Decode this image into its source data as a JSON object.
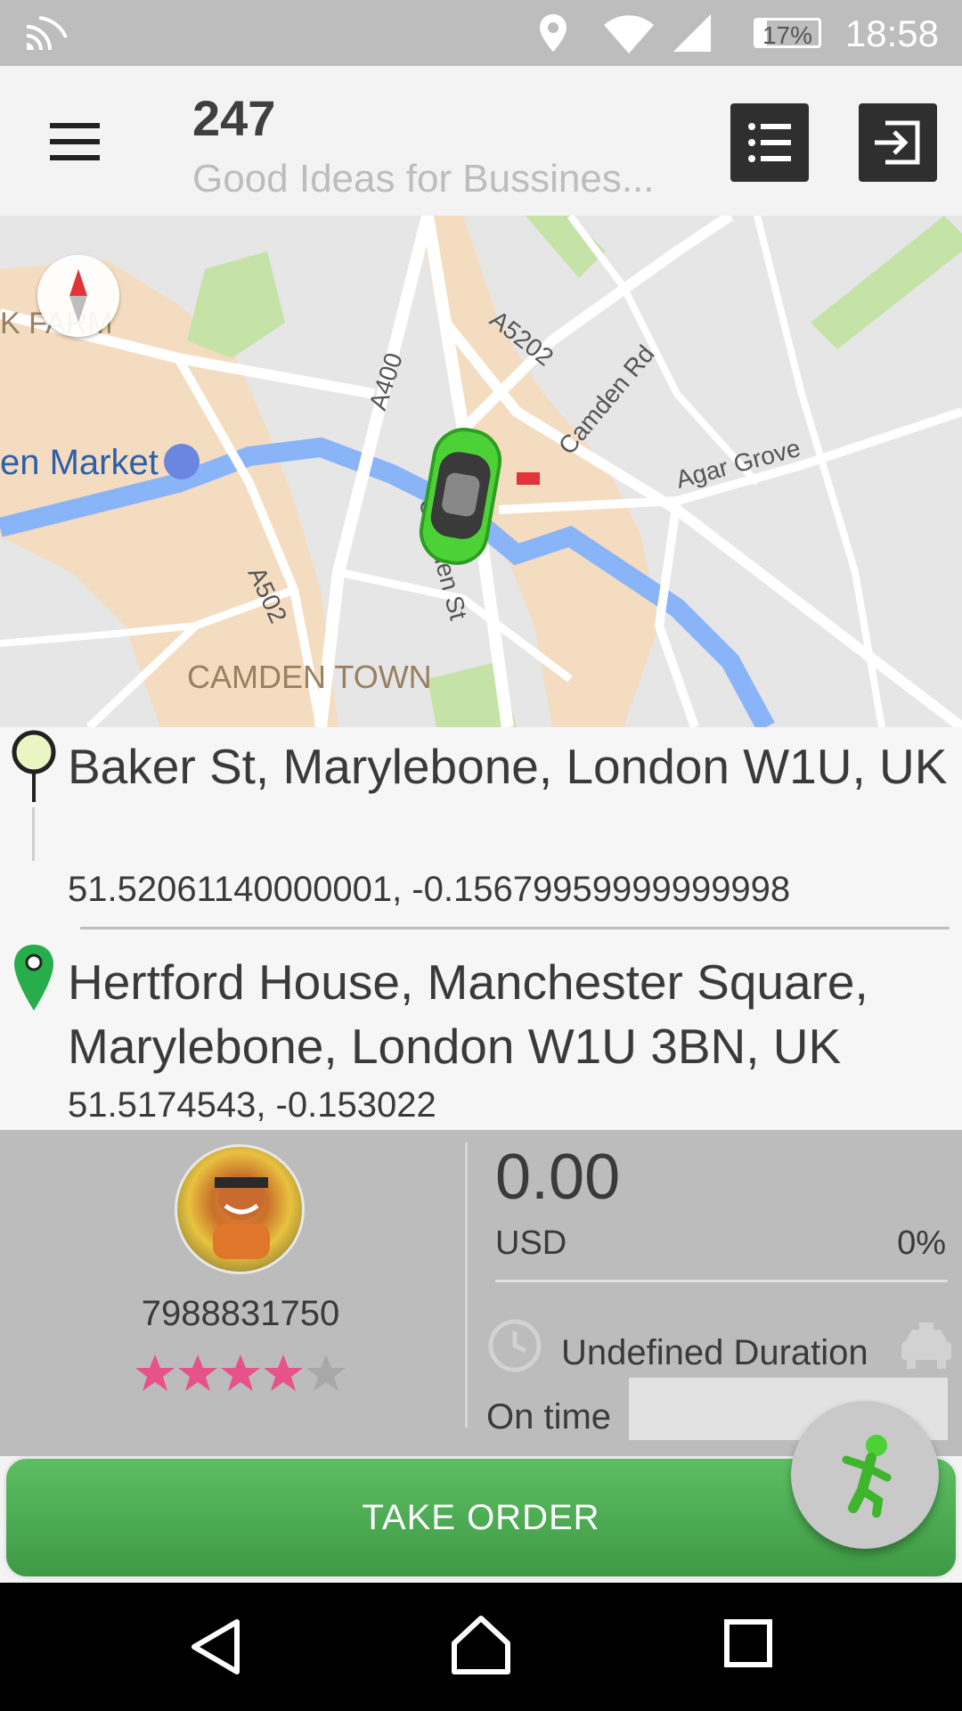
{
  "status_bar": {
    "time": "18:58",
    "battery": "17%",
    "battery_level": 0.17,
    "icons": [
      "cast-icon",
      "location-icon",
      "wifi-icon",
      "signal-icon",
      "battery-icon"
    ]
  },
  "app_bar": {
    "title": "247",
    "subtitle": "Good Ideas for Bussines...",
    "menu_icon": "hamburger-icon",
    "list_icon": "list-icon",
    "logout_icon": "exit-icon"
  },
  "map": {
    "labels": {
      "farm": "K FARM",
      "market": "en Market",
      "a400": "A400",
      "a5202": "A5202",
      "camden_rd": "Camden Rd",
      "agar_grove": "Agar Grove",
      "a502": "A502",
      "camden_st": "Camden St",
      "camden_town": "CAMDEN TOWN"
    },
    "colors": {
      "road": "#ffffff",
      "water": "#8ab4f8",
      "park": "#c5e3a6",
      "urban": "#f4dcc0",
      "base": "#e6e6e6"
    }
  },
  "route": {
    "origin": {
      "address": "Baker St, Marylebone, London W1U, UK",
      "coords": "51.52061140000001, -0.15679959999999998"
    },
    "destination": {
      "address": "Hertford House, Manchester Square, Marylebone, London W1U 3BN, UK",
      "coords": "51.5174543, -0.153022"
    }
  },
  "driver": {
    "phone": "7988831750",
    "rating": 4,
    "rating_max": 5,
    "star_color": "#e8528a"
  },
  "fare": {
    "price": "0.00",
    "currency": "USD",
    "percent": "0%",
    "duration": "Undefined Duration",
    "on_time": "On time"
  },
  "actions": {
    "take_order": "TAKE ORDER"
  },
  "accent": "#4caf50"
}
